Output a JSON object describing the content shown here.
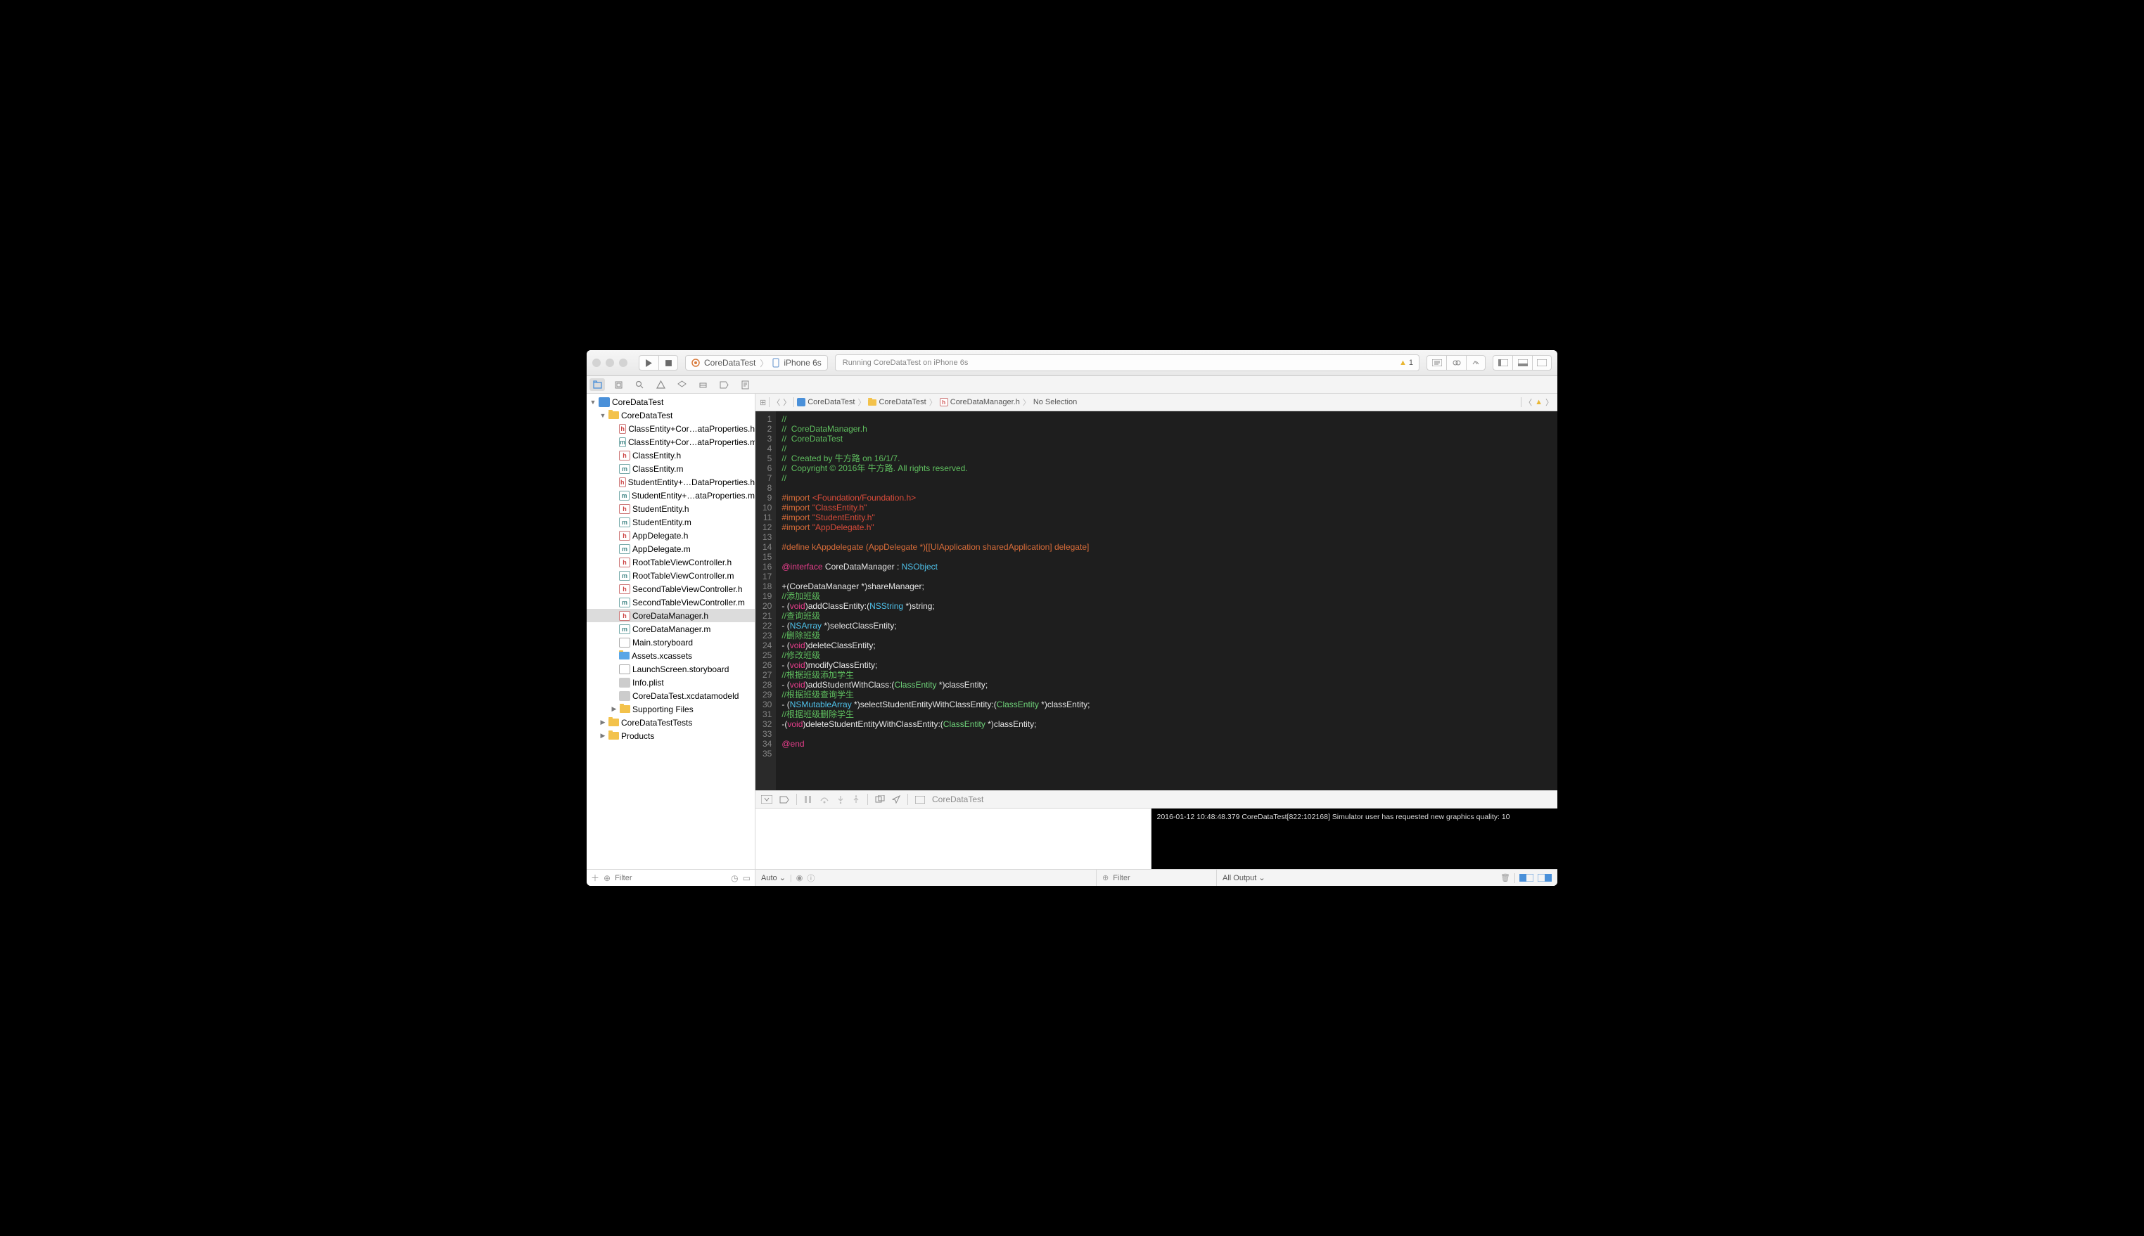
{
  "toolbar": {
    "scheme_target": "CoreDataTest",
    "scheme_device": "iPhone 6s",
    "status_text": "Running CoreDataTest on iPhone 6s",
    "warning_count": "1"
  },
  "breadcrumb": {
    "items": [
      "CoreDataTest",
      "CoreDataTest",
      "CoreDataManager.h",
      "No Selection"
    ]
  },
  "project_tree": {
    "root": "CoreDataTest",
    "group": "CoreDataTest",
    "files": [
      {
        "icon": "h",
        "name": "ClassEntity+Cor…ataProperties.h"
      },
      {
        "icon": "m",
        "name": "ClassEntity+Cor…ataProperties.m"
      },
      {
        "icon": "h",
        "name": "ClassEntity.h"
      },
      {
        "icon": "m",
        "name": "ClassEntity.m"
      },
      {
        "icon": "h",
        "name": "StudentEntity+…DataProperties.h"
      },
      {
        "icon": "m",
        "name": "StudentEntity+…ataProperties.m"
      },
      {
        "icon": "h",
        "name": "StudentEntity.h"
      },
      {
        "icon": "m",
        "name": "StudentEntity.m"
      },
      {
        "icon": "h",
        "name": "AppDelegate.h"
      },
      {
        "icon": "m",
        "name": "AppDelegate.m"
      },
      {
        "icon": "h",
        "name": "RootTableViewController.h"
      },
      {
        "icon": "m",
        "name": "RootTableViewController.m"
      },
      {
        "icon": "h",
        "name": "SecondTableViewController.h"
      },
      {
        "icon": "m",
        "name": "SecondTableViewController.m"
      },
      {
        "icon": "h",
        "name": "CoreDataManager.h",
        "selected": true
      },
      {
        "icon": "m",
        "name": "CoreDataManager.m"
      },
      {
        "icon": "sb",
        "name": "Main.storyboard"
      },
      {
        "icon": "folder-blue",
        "name": "Assets.xcassets"
      },
      {
        "icon": "sb",
        "name": "LaunchScreen.storyboard"
      },
      {
        "icon": "gray",
        "name": "Info.plist"
      },
      {
        "icon": "gray",
        "name": "CoreDataTest.xcdatamodeld"
      }
    ],
    "supporting": "Supporting Files",
    "tests": "CoreDataTestTests",
    "products": "Products",
    "filter_placeholder": "Filter"
  },
  "code_lines": [
    {
      "n": 1,
      "cls": "c-comment",
      "t": "//"
    },
    {
      "n": 2,
      "cls": "c-comment",
      "t": "//  CoreDataManager.h"
    },
    {
      "n": 3,
      "cls": "c-comment",
      "t": "//  CoreDataTest"
    },
    {
      "n": 4,
      "cls": "c-comment",
      "t": "//"
    },
    {
      "n": 5,
      "cls": "c-comment",
      "t": "//  Created by 牛方路 on 16/1/7."
    },
    {
      "n": 6,
      "cls": "c-comment",
      "t": "//  Copyright © 2016年 牛方路. All rights reserved."
    },
    {
      "n": 7,
      "cls": "c-comment",
      "t": "//"
    },
    {
      "n": 8,
      "cls": "",
      "t": ""
    },
    {
      "n": 9,
      "html": "<span class='c-pp'>#import </span><span class='c-str'>&lt;Foundation/Foundation.h&gt;</span>"
    },
    {
      "n": 10,
      "html": "<span class='c-pp'>#import </span><span class='c-str'>\"ClassEntity.h\"</span>"
    },
    {
      "n": 11,
      "html": "<span class='c-pp'>#import </span><span class='c-str'>\"StudentEntity.h\"</span>"
    },
    {
      "n": 12,
      "html": "<span class='c-pp'>#import </span><span class='c-str'>\"AppDelegate.h\"</span>"
    },
    {
      "n": 13,
      "cls": "",
      "t": ""
    },
    {
      "n": 14,
      "html": "<span class='c-pp'>#define kAppdelegate (AppDelegate *)[[UIApplication sharedApplication] delegate]</span>"
    },
    {
      "n": 15,
      "cls": "",
      "t": ""
    },
    {
      "n": 16,
      "html": "<span class='c-kw'>@interface</span> CoreDataManager : <span class='c-type'>NSObject</span>"
    },
    {
      "n": 17,
      "cls": "",
      "t": ""
    },
    {
      "n": 18,
      "html": "+(CoreDataManager *)shareManager;"
    },
    {
      "n": 19,
      "cls": "c-comment",
      "t": "//添加班级"
    },
    {
      "n": 20,
      "html": "- (<span class='c-kw'>void</span>)addClassEntity:(<span class='c-type'>NSString</span> *)string;"
    },
    {
      "n": 21,
      "cls": "c-comment",
      "t": "//查询班级"
    },
    {
      "n": 22,
      "html": "- (<span class='c-type'>NSArray</span> *)selectClassEntity;"
    },
    {
      "n": 23,
      "cls": "c-comment",
      "t": "//删除班级"
    },
    {
      "n": 24,
      "html": "- (<span class='c-kw'>void</span>)deleteClassEntity;"
    },
    {
      "n": 25,
      "cls": "c-comment",
      "t": "//修改班级"
    },
    {
      "n": 26,
      "html": "- (<span class='c-kw'>void</span>)modifyClassEntity;"
    },
    {
      "n": 27,
      "cls": "c-comment",
      "t": "//根据班级添加学生"
    },
    {
      "n": 28,
      "html": "- (<span class='c-kw'>void</span>)addStudentWithClass:(<span class='c-cls'>ClassEntity</span> *)classEntity;"
    },
    {
      "n": 29,
      "cls": "c-comment",
      "t": "//根据班级查询学生"
    },
    {
      "n": 30,
      "html": "- (<span class='c-type'>NSMutableArray</span> *)selectStudentEntityWithClassEntity:(<span class='c-cls'>ClassEntity</span> *)classEntity;"
    },
    {
      "n": 31,
      "cls": "c-comment",
      "t": "//根据班级删除学生"
    },
    {
      "n": 32,
      "html": "-(<span class='c-kw'>void</span>)deleteStudentEntityWithClassEntity:(<span class='c-cls'>ClassEntity</span> *)classEntity;"
    },
    {
      "n": 33,
      "cls": "",
      "t": ""
    },
    {
      "n": 34,
      "html": "<span class='c-kw'>@end</span>"
    },
    {
      "n": 35,
      "cls": "",
      "t": ""
    }
  ],
  "debug": {
    "process": "CoreDataTest",
    "console_text": "2016-01-12 10:48:48.379 CoreDataTest[822:102168] Simulator user has requested new graphics quality: 10",
    "auto_label": "Auto",
    "filter_placeholder": "Filter",
    "output_label": "All Output"
  }
}
